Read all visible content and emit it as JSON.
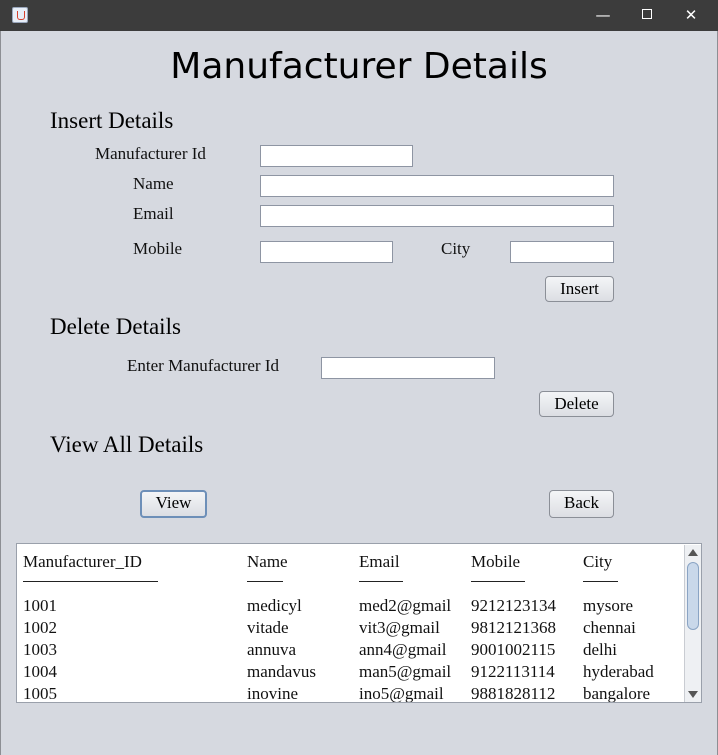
{
  "window": {
    "title": "",
    "controls": {
      "minimize": "—",
      "maximize": "",
      "close": "✕"
    }
  },
  "page_title": "Manufacturer Details",
  "insert": {
    "heading": "Insert Details",
    "manufacturer_id_label": "Manufacturer Id",
    "name_label": "Name",
    "email_label": "Email",
    "mobile_label": "Mobile",
    "city_label": "City",
    "manufacturer_id_value": "",
    "name_value": "",
    "email_value": "",
    "mobile_value": "",
    "city_value": "",
    "insert_button": "Insert"
  },
  "delete": {
    "heading": "Delete Details",
    "id_label": "Enter Manufacturer Id",
    "id_value": "",
    "delete_button": "Delete"
  },
  "view": {
    "heading": "View All Details",
    "view_button": "View",
    "back_button": "Back"
  },
  "table": {
    "headers": [
      "Manufacturer_ID",
      "Name",
      "Email",
      "Mobile",
      "City"
    ],
    "rows": [
      [
        "1001",
        "medicyl",
        "med2@gmail",
        "9212123134",
        "mysore"
      ],
      [
        "1002",
        "vitade",
        "vit3@gmail",
        "9812121368",
        "chennai"
      ],
      [
        "1003",
        "annuva",
        "ann4@gmail",
        "9001002115",
        "delhi"
      ],
      [
        "1004",
        "mandavus",
        "man5@gmail",
        "9122113114",
        "hyderabad"
      ],
      [
        "1005",
        "inovine",
        "ino5@gmail",
        "9881828112",
        "bangalore"
      ]
    ]
  }
}
